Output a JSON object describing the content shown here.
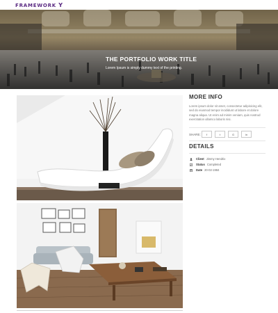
{
  "brand": {
    "name": "FRAMEWORK",
    "mark": "Y"
  },
  "hero": {
    "title": "THE PORTFOLIO WORK TITLE",
    "subtitle": "Lorem Ipsum is simply dummy text of the printing."
  },
  "info": {
    "heading": "MORE INFO",
    "description": "Lorem ipsum dolor sit amet, consectetur adipisicing elit, sed do eiusmod tempor incididunt ut labore et dolore magna aliqua. Ut enim ad minim veniam, quis nostrud exercitation ullamco laboris nisi."
  },
  "share": {
    "label": "SHARE:",
    "buttons": [
      {
        "icon": "facebook-icon",
        "glyph": "f"
      },
      {
        "icon": "twitter-icon",
        "glyph": "t"
      },
      {
        "icon": "google-plus-icon",
        "glyph": "G"
      },
      {
        "icon": "linkedin-icon",
        "glyph": "in"
      }
    ]
  },
  "details": {
    "heading": "DETAILS",
    "client_label": "Client",
    "client_value": "Jimmy Hendrix",
    "status_label": "Status",
    "status_value": "Completed",
    "date_label": "Date",
    "date_value": "20-02-1984"
  },
  "colors": {
    "brand": "#5a2a82",
    "text": "#444444",
    "border": "#e4e4e4"
  }
}
